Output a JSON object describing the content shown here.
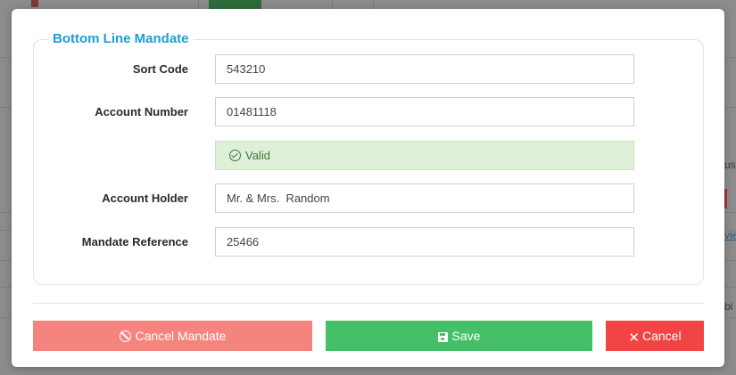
{
  "background": {
    "right_fragments": [
      "us",
      "vie",
      "bi"
    ]
  },
  "modal": {
    "legend": "Bottom Line Mandate",
    "fields": [
      {
        "label": "Sort Code",
        "value": "543210"
      },
      {
        "label": "Account Number",
        "value": "01481118"
      },
      {
        "label": "Account Holder",
        "value": "Mr. & Mrs.  Random"
      },
      {
        "label": "Mandate Reference",
        "value": "25466"
      }
    ],
    "validation": {
      "text": "Valid",
      "icon": "check-circle-icon"
    },
    "buttons": {
      "cancel_mandate": "Cancel Mandate",
      "save": "Save",
      "cancel": "Cancel"
    }
  },
  "colors": {
    "legend": "#1a9fd9",
    "cancel_mandate": "#f5847f",
    "save": "#46c068",
    "cancel": "#f14444",
    "valid_bg": "#dff0d8"
  }
}
